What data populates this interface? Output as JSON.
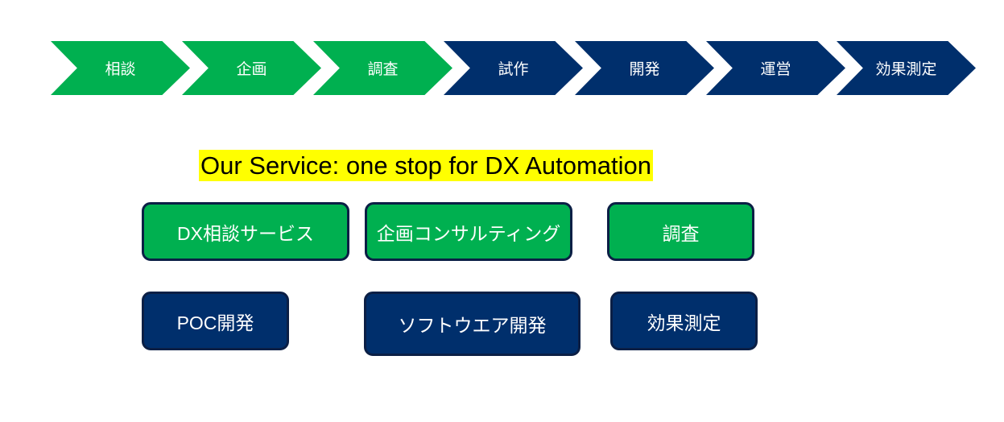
{
  "colors": {
    "green": "#00b050",
    "navy": "#002f6c",
    "highlight": "#ffff00"
  },
  "process_steps": [
    {
      "label": "相談",
      "color": "green"
    },
    {
      "label": "企画",
      "color": "green"
    },
    {
      "label": "調査",
      "color": "green"
    },
    {
      "label": "試作",
      "color": "navy"
    },
    {
      "label": "開発",
      "color": "navy"
    },
    {
      "label": "運営",
      "color": "navy"
    },
    {
      "label": "効果測定",
      "color": "navy"
    }
  ],
  "title": "Our Service: one stop for DX Automation",
  "services": [
    {
      "label": "DX相談サービス",
      "color": "green"
    },
    {
      "label": "企画コンサルティング",
      "color": "green"
    },
    {
      "label": "調査",
      "color": "green"
    },
    {
      "label": "POC開発",
      "color": "navy"
    },
    {
      "label": "ソフトウエア開発",
      "color": "navy"
    },
    {
      "label": "効果測定",
      "color": "navy"
    }
  ]
}
